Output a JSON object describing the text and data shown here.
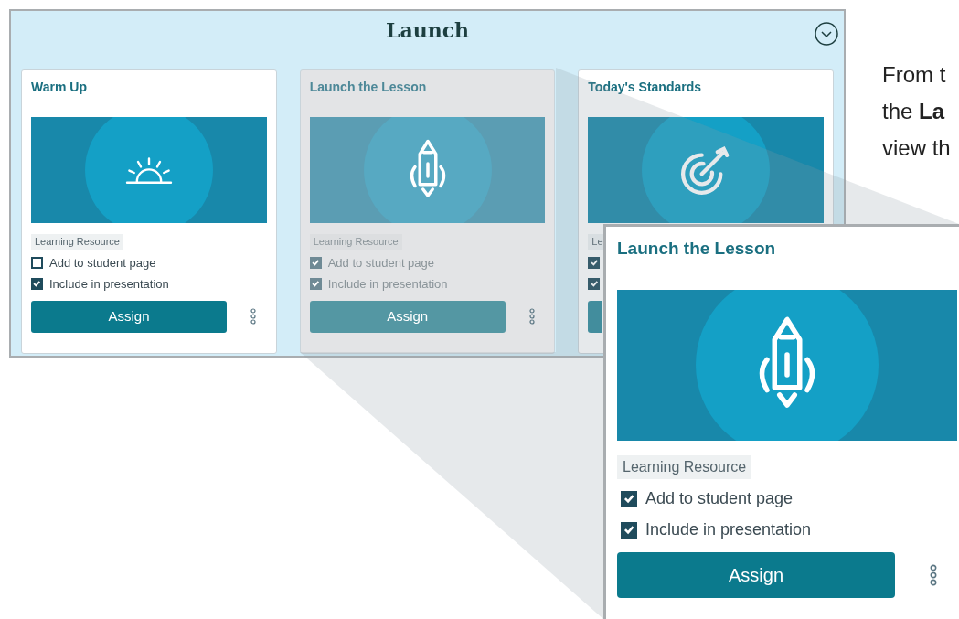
{
  "panel": {
    "title": "Launch"
  },
  "cards": [
    {
      "title": "Warm Up",
      "kind": "sun",
      "dimmed": false,
      "tag": "Learning Resource",
      "options": [
        {
          "label": "Add to student page",
          "checked": false
        },
        {
          "label": "Include in presentation",
          "checked": true
        }
      ],
      "button": "Assign"
    },
    {
      "title": "Launch the Lesson",
      "kind": "rocket",
      "dimmed": true,
      "tag": "Learning Resource",
      "options": [
        {
          "label": "Add to student page",
          "checked": true
        },
        {
          "label": "Include in presentation",
          "checked": true
        }
      ],
      "button": "Assign"
    },
    {
      "title": "Today's Standards",
      "kind": "target",
      "dimmed": false,
      "tag": "Le",
      "options": [
        {
          "checked": true
        },
        {
          "checked": true
        }
      ]
    }
  ],
  "description": {
    "lines": [
      "From t",
      "the **La**",
      "view th"
    ]
  },
  "callout": {
    "title": "Launch the Lesson",
    "kind": "rocket",
    "tag": "Learning Resource",
    "options": [
      {
        "label": "Add to student page",
        "checked": true
      },
      {
        "label": "Include in presentation",
        "checked": true
      }
    ],
    "button": "Assign"
  }
}
